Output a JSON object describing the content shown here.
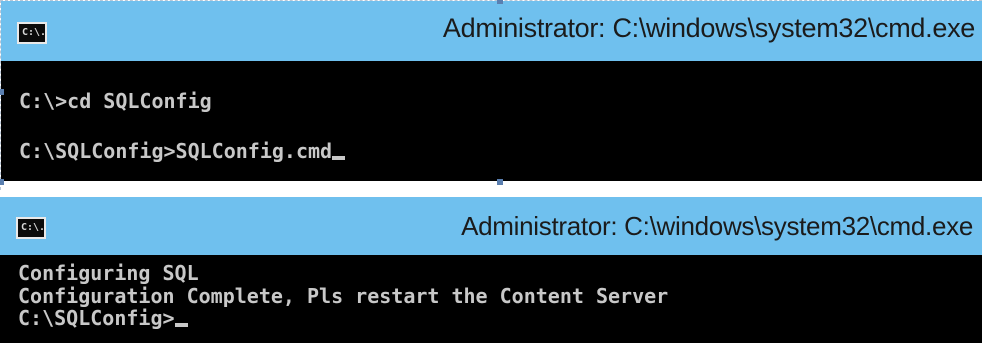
{
  "windows": [
    {
      "title": "Administrator: C:\\windows\\system32\\cmd.exe",
      "icon": "cmd-icon",
      "icon_text": "C:\\.",
      "lines": [
        "C:\\>cd SQLConfig",
        "C:\\SQLConfig>SQLConfig.cmd"
      ]
    },
    {
      "title": "Administrator: C:\\windows\\system32\\cmd.exe",
      "icon": "cmd-icon",
      "icon_text": "C:\\.",
      "lines": [
        "Configuring SQL",
        "Configuration Complete, Pls restart the Content Server",
        "C:\\SQLConfig>"
      ]
    }
  ],
  "colors": {
    "titlebar": "#6fc0ee",
    "console_bg": "#000000",
    "console_text": "#c8c8c8"
  }
}
